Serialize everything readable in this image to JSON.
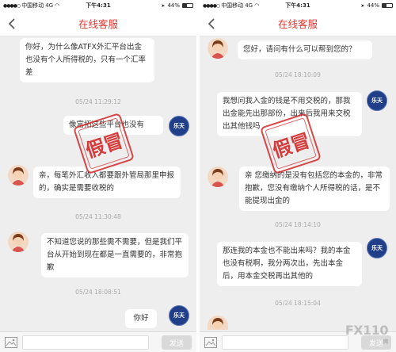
{
  "left": {
    "status": {
      "carrier": "中国移动",
      "network": "4G",
      "time": "下午4:31",
      "battery_text": "44%",
      "battery_level": 0.44
    },
    "nav": {
      "title": "在线客服"
    },
    "messages": [
      {
        "text": "你好，为什么像ATFX外汇平台出金也没有个人所得税的，只有一个汇率差"
      },
      {
        "time": "05/24 11:29:12"
      },
      {
        "text": "像富拓这些平台也没有"
      },
      {
        "text": "亲，每笔外汇收入都要跟外管局那里申报的，确实是需要收税的"
      },
      {
        "time": "05/24 11:30:48"
      },
      {
        "text": "不知道您说的那些需不需要，但是我们平台从开始到现在都是一直需要的，非常抱歉"
      },
      {
        "time": "05/24 18:08:51"
      },
      {
        "text": "你好"
      }
    ],
    "stamp": "假冒",
    "input": {
      "placeholder": "",
      "send_label": "发送"
    }
  },
  "right": {
    "status": {
      "carrier": "中国移动",
      "network": "4G",
      "time": "下午4:31",
      "battery_text": "44%",
      "battery_level": 0.44
    },
    "nav": {
      "title": "在线客服"
    },
    "messages": [
      {
        "text": "您好，请问有什么可以帮到您的？"
      },
      {
        "time": "05/24 18:10:09"
      },
      {
        "text": "我想问我入金的钱是不用交税的，那我出金能先出那部份，出来后我用来交税出其他钱吗"
      },
      {
        "text": "亲 您缴纳的是没有包括您的本金的，非常抱歉，您没有缴纳个人所得税的话，是不能提现出金的"
      },
      {
        "time": "05/24 18:14:10"
      },
      {
        "text": "那连我的本金也不能出来吗？我的本金也没有税啊，我分两次出，先出本金后，用本金交税再出其他的"
      },
      {
        "time": "05/24 18:15:04"
      }
    ],
    "stamp": "假冒",
    "input": {
      "placeholder": "",
      "send_label": "发送"
    },
    "watermark": {
      "brand": "FX110",
      "sub": "网"
    }
  },
  "avatar_logo_text": "乐天"
}
